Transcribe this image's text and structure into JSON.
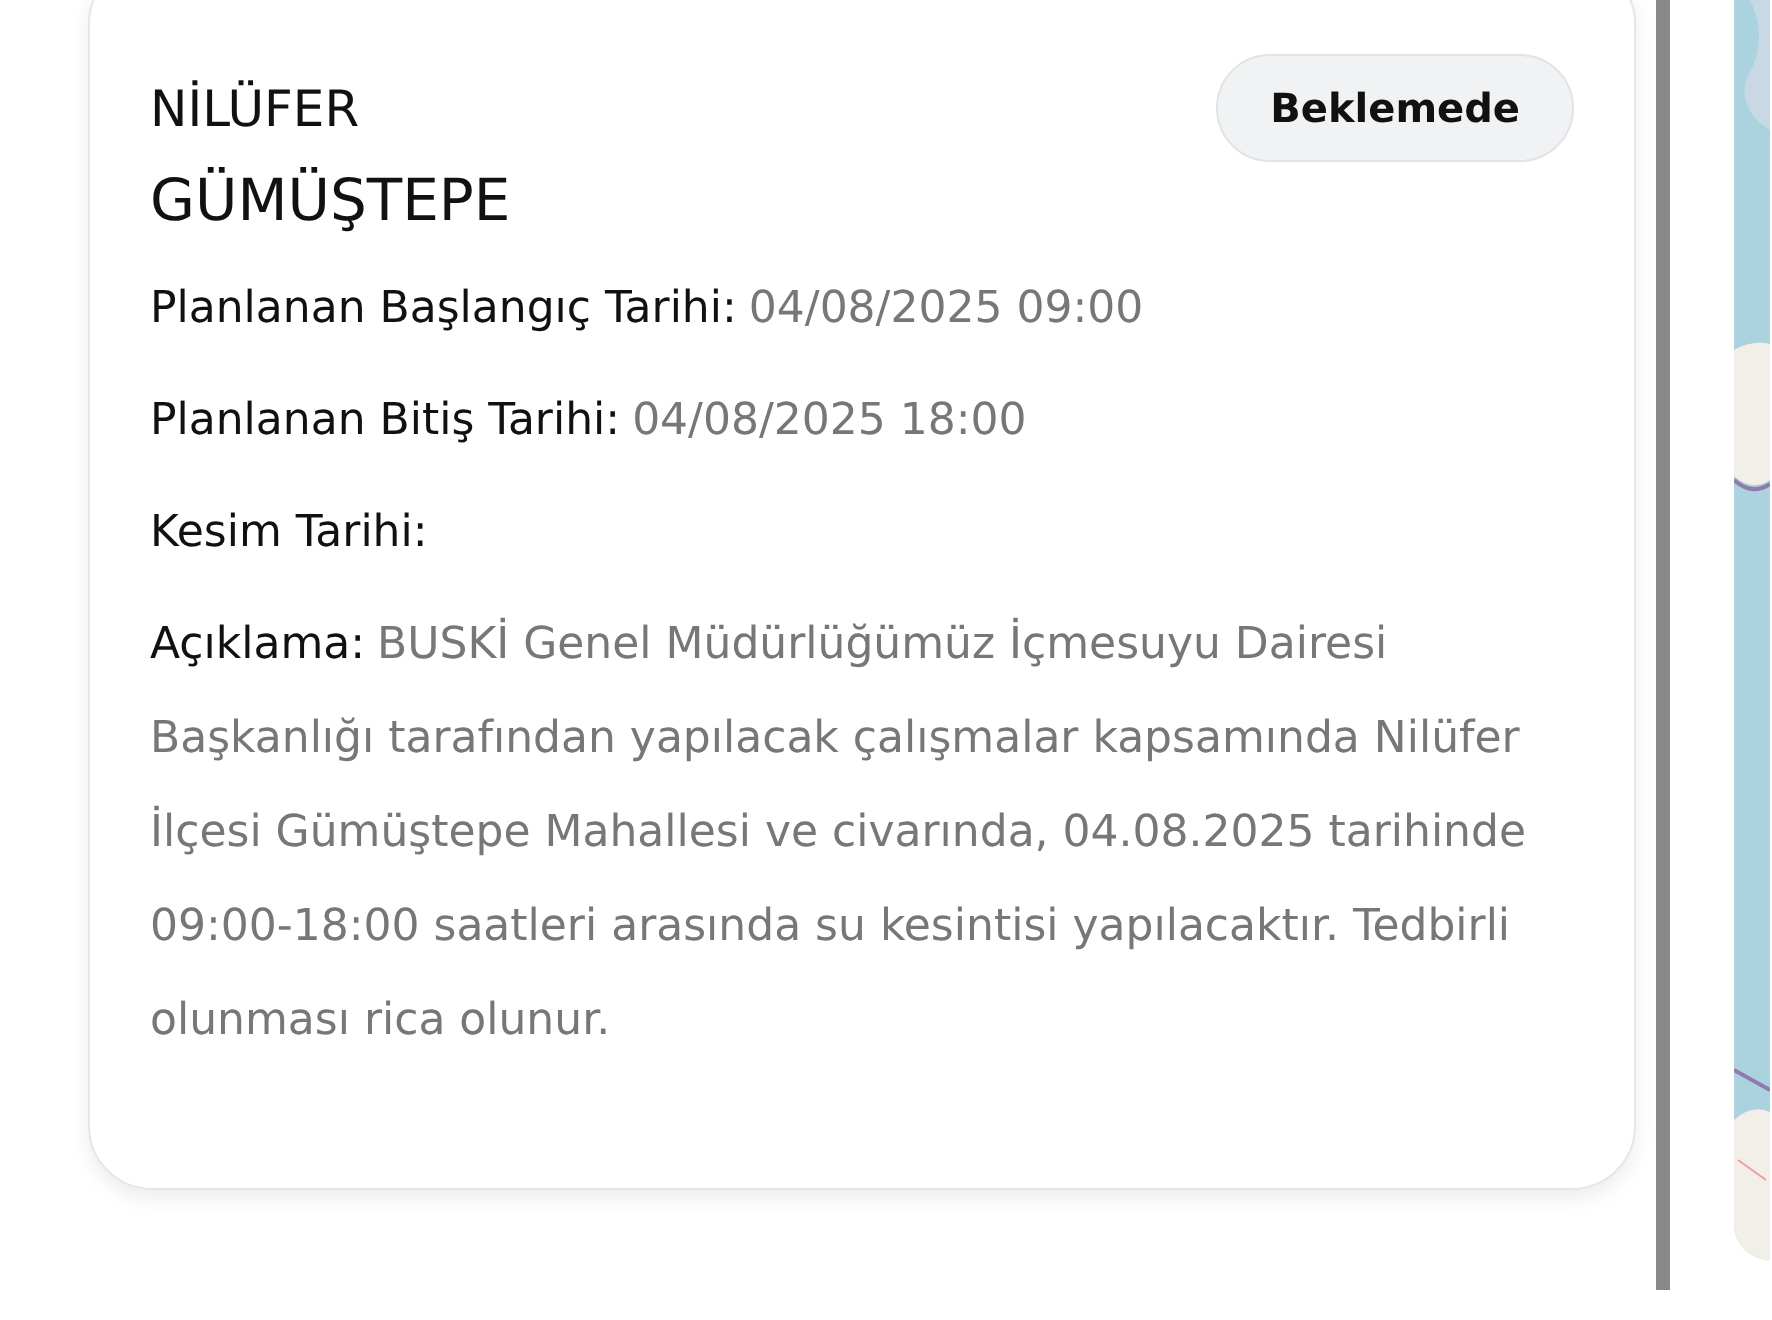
{
  "card": {
    "district": "NİLÜFER",
    "neighborhood": "GÜMÜŞTEPE",
    "status": "Beklemede",
    "fields": [
      {
        "label": "Planlanan Başlangıç Tarihi:",
        "value": "04/08/2025 09:00"
      },
      {
        "label": "Planlanan Bitiş Tarihi:",
        "value": "04/08/2025 18:00"
      },
      {
        "label": "Kesim Tarihi:"
      },
      {
        "label": "Açıklama:",
        "value": "BUSKİ Genel Müdürlüğümüz İçmesuyu Dairesi Başkanlığı tarafından yapılacak çalışmalar kapsamında Nilüfer İlçesi Gümüştepe Mahallesi ve civarında, 04.08.2025 tarihinde 09:00-18:00 saatleri arasında su kesintisi yapılacaktır. Tedbirli olunması rica olunur."
      }
    ]
  }
}
